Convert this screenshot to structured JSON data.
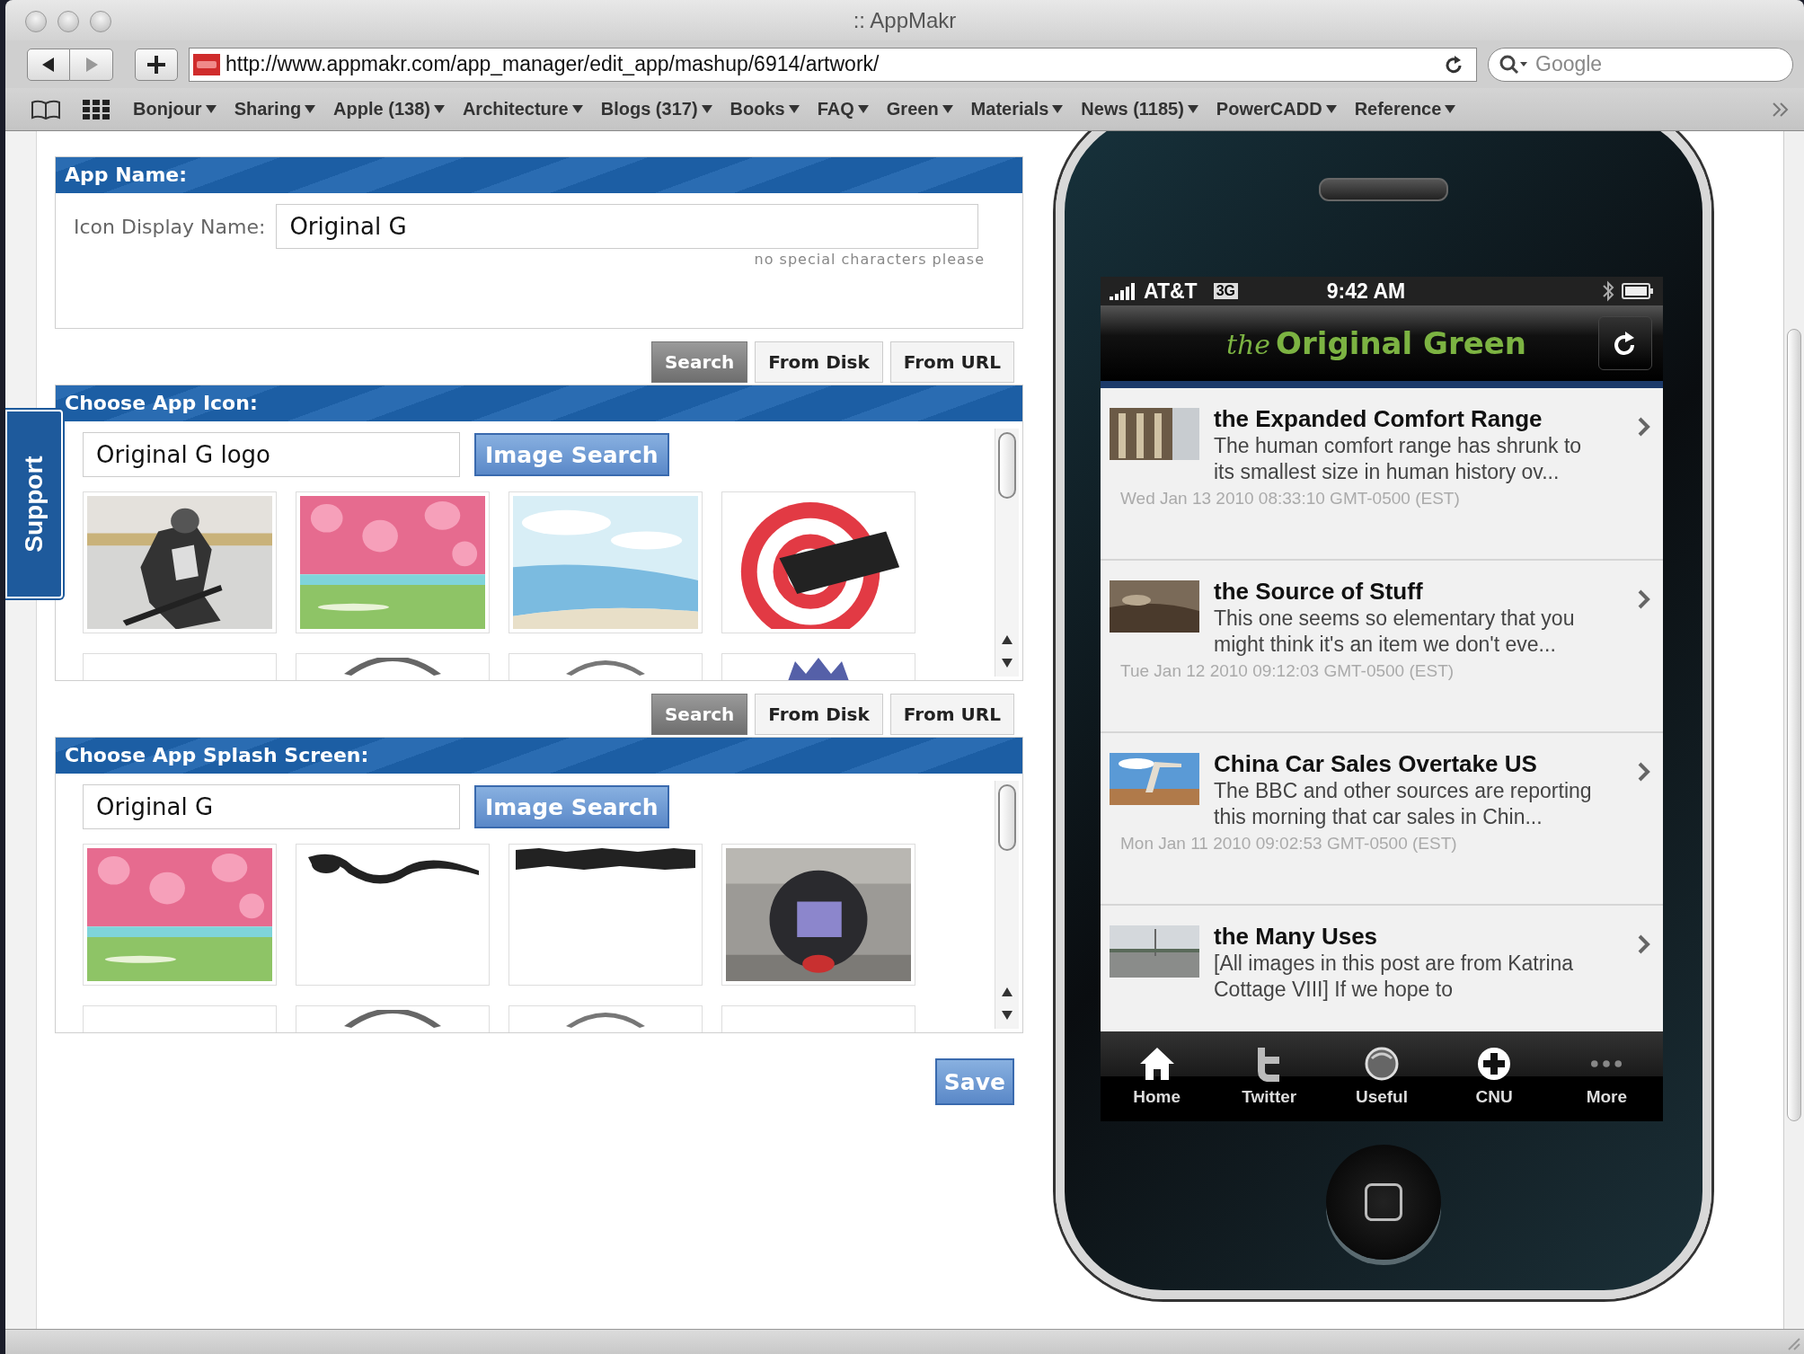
{
  "window": {
    "title": ":: AppMakr"
  },
  "toolbar": {
    "url": "http://www.appmakr.com/app_manager/edit_app/mashup/6914/artwork/",
    "search": {
      "placeholder": "Google"
    }
  },
  "bookmarks": [
    "Bonjour",
    "Sharing",
    "Apple (138)",
    "Architecture",
    "Blogs (317)",
    "Books",
    "FAQ",
    "Green",
    "Materials",
    "News (1185)",
    "PowerCADD",
    "Reference"
  ],
  "support_tab": "Support",
  "app_name": {
    "heading": "App Name:",
    "label": "Icon Display Name:",
    "value": "Original G",
    "hint": "no special characters please"
  },
  "image_pickers": [
    {
      "sources": [
        {
          "label": "Search",
          "selected": true
        },
        {
          "label": "From Disk",
          "selected": false
        },
        {
          "label": "From URL",
          "selected": false
        }
      ],
      "heading": "Choose App Icon:",
      "query": "Original G logo",
      "search_button": "Image Search",
      "thumbnails": [
        {
          "kind": "picture"
        },
        {
          "kind": "picture"
        },
        {
          "kind": "picture"
        },
        {
          "kind": "picture"
        },
        {
          "kind": "empty"
        },
        {
          "kind": "picture"
        },
        {
          "kind": "picture"
        },
        {
          "kind": "picture"
        }
      ]
    },
    {
      "sources": [
        {
          "label": "Search",
          "selected": true
        },
        {
          "label": "From Disk",
          "selected": false
        },
        {
          "label": "From URL",
          "selected": false
        }
      ],
      "heading": "Choose App Splash Screen:",
      "query": "Original G",
      "search_button": "Image Search",
      "thumbnails": [
        {
          "kind": "picture"
        },
        {
          "kind": "picture"
        },
        {
          "kind": "picture"
        },
        {
          "kind": "picture"
        },
        {
          "kind": "empty"
        },
        {
          "kind": "picture"
        },
        {
          "kind": "picture"
        },
        {
          "kind": "empty"
        }
      ]
    }
  ],
  "save_button": "Save",
  "phone": {
    "carrier": "AT&T",
    "network": "3G",
    "time": "9:42 AM",
    "app_title": {
      "prefix": "the",
      "name": "Original Green"
    },
    "articles": [
      {
        "title": "the Expanded Comfort Range",
        "summary": "The human comfort range has shrunk to its smallest size in human history ov...",
        "date": "Wed Jan 13 2010 08:33:10 GMT-0500 (EST)"
      },
      {
        "title": "the Source of Stuff",
        "summary": "This one seems so elementary that you might think it's an item we don't eve...",
        "date": "Tue Jan 12 2010 09:12:03 GMT-0500 (EST)"
      },
      {
        "title": "China Car Sales Overtake US",
        "summary": "The BBC and other sources are reporting this morning that car sales in Chin...",
        "date": "Mon Jan 11 2010 09:02:53 GMT-0500 (EST)"
      },
      {
        "title": "the Many Uses",
        "summary": "[All images in this post are from Katrina Cottage VIII] If we hope to"
      }
    ],
    "tabs": [
      {
        "kind": "home",
        "label": "Home"
      },
      {
        "kind": "bird",
        "label": "Twitter"
      },
      {
        "kind": "globe",
        "label": "Useful"
      },
      {
        "kind": "plus",
        "label": "CNU"
      },
      {
        "kind": "more",
        "label": "More"
      }
    ]
  }
}
